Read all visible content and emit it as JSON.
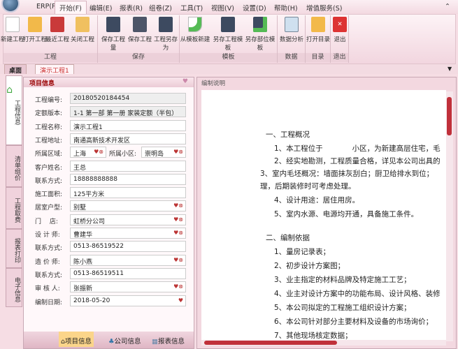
{
  "menu": [
    "ERP(P)",
    "开始(F)",
    "编辑(E)",
    "报表(R)",
    "组卷(Z)",
    "工具(T)",
    "视图(V)",
    "设置(D)",
    "帮助(H)",
    "增值服务(S)"
  ],
  "ribbon": {
    "groups": [
      "工程",
      "保存",
      "模板",
      "数据",
      "目录",
      "退出"
    ],
    "buttons": [
      "新建工程",
      "打开工程",
      "最近工程",
      "关闭工程",
      "保存工程量",
      "保存工程",
      "工程另存为",
      "从模板新建",
      "另存工程模板",
      "另存部位模板",
      "数据分析",
      "打开目录",
      "退出"
    ]
  },
  "doc_tabs": [
    "桌面",
    "演示工程1"
  ],
  "side_tabs": [
    "工程信息",
    "清单组价",
    "工程取费",
    "报表打印",
    "电子信息"
  ],
  "project": {
    "title": "项目信息",
    "fields": [
      {
        "label": "工程编号:",
        "value": "20180520184454"
      },
      {
        "label": "定额版本:",
        "value": "1-1 第一部 第一册 家装定额（半包）"
      },
      {
        "label": "工程名称:",
        "value": "演示工程1"
      },
      {
        "label": "工程地址:",
        "value": "南通高新技术开发区"
      },
      {
        "label": "所属区域:",
        "value": "上海",
        "label2": "所属小区:",
        "value2": "崇明岛"
      },
      {
        "label": "客户姓名:",
        "value": "王总"
      },
      {
        "label": "联系方式:",
        "value": "18888888888"
      },
      {
        "label": "施工面积:",
        "value": "125平方米"
      },
      {
        "label": "居室户型:",
        "value": "别墅"
      },
      {
        "label": "门　 店:",
        "value": "虹桥分公司"
      },
      {
        "label": "设 计 师:",
        "value": "曹建华"
      },
      {
        "label": "联系方式:",
        "value": "0513-86519522"
      },
      {
        "label": "造 价 师:",
        "value": "陈小燕"
      },
      {
        "label": "联系方式:",
        "value": "0513-86519511"
      },
      {
        "label": "审 核 人:",
        "value": "张振新"
      },
      {
        "label": "编制日期:",
        "value": "2018-05-20"
      }
    ],
    "bottom_tabs": [
      "项目信息",
      "公司信息",
      "报表信息"
    ]
  },
  "editor": {
    "title": "编制说明",
    "lines": [
      "一、工程概况",
      "1、本工程位于　　　　小区，为新建高层住宅，毛",
      "2、经实地勘测，工程质量合格，详见本公司出具的",
      "3、室内毛坯概况：墙面抹灰刮白；厨卫给排水到位；",
      "理，后期装修时可考虑处理。",
      "4、设计用途：居住用房。",
      "5、室内水源、电源均开通，具备施工条件。",
      "二、编制依据",
      "1、量房记录表；",
      "2、初步设计方案图；",
      "3、业主指定的材料品牌及特定施工工艺；",
      "4、业主对设计方案中的功能布局、设计风格、装修",
      "5、本公司拟定的工程施工组织设计方案；",
      "6、本公司针对部分主要材料及设备的市场询价；",
      "7、其他现场核定数据；"
    ]
  }
}
